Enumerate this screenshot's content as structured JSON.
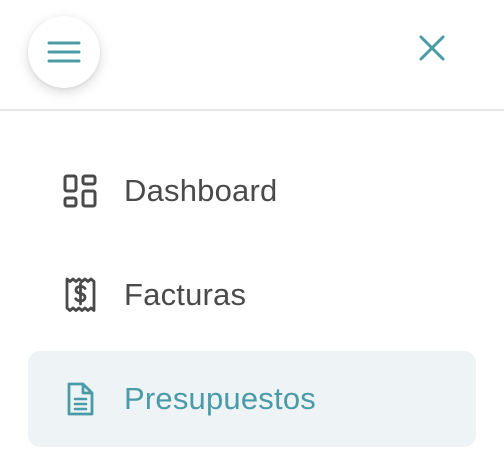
{
  "colors": {
    "accent": "#4a9ba8",
    "text": "#4a4a4a",
    "active_background": "#eef3f5",
    "divider": "#e6e6e6"
  },
  "header": {
    "menu_icon": "hamburger-menu-icon",
    "close_icon": "close-icon"
  },
  "nav": {
    "items": [
      {
        "label": "Dashboard",
        "icon": "dashboard-grid-icon",
        "active": false
      },
      {
        "label": "Facturas",
        "icon": "receipt-dollar-icon",
        "active": false
      },
      {
        "label": "Presupuestos",
        "icon": "document-icon",
        "active": true
      }
    ]
  }
}
